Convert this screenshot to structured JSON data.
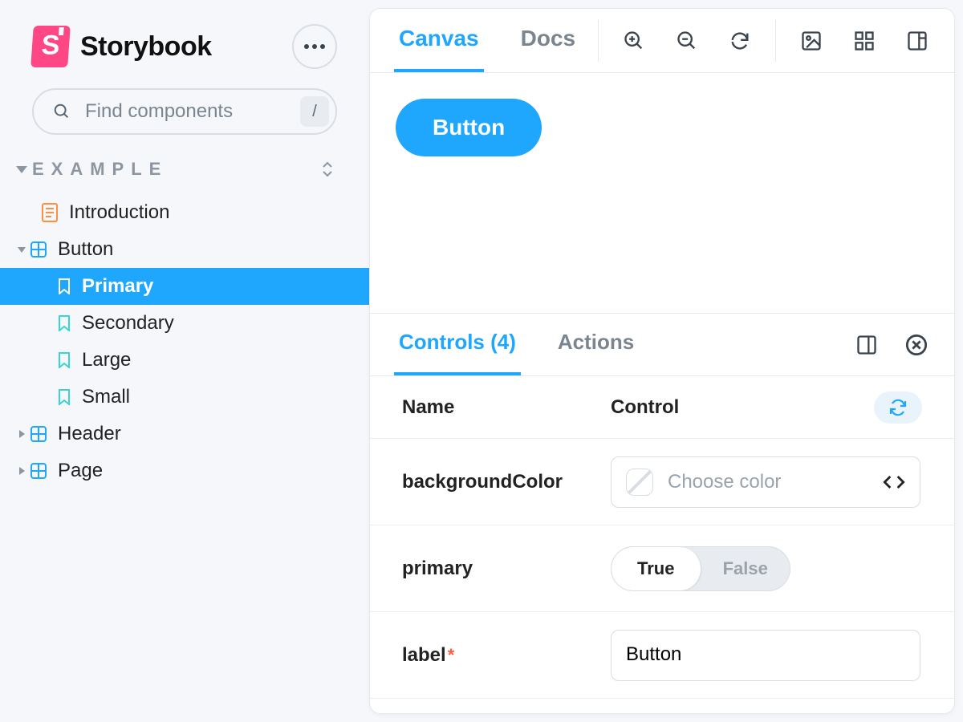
{
  "brand": {
    "name": "Storybook"
  },
  "search": {
    "placeholder": "Find components",
    "shortcut": "/"
  },
  "section": {
    "title": "Example"
  },
  "tree": {
    "introduction": "Introduction",
    "button": "Button",
    "stories": {
      "primary": "Primary",
      "secondary": "Secondary",
      "large": "Large",
      "small": "Small"
    },
    "header": "Header",
    "page": "Page"
  },
  "tabs": {
    "canvas": "Canvas",
    "docs": "Docs"
  },
  "canvas": {
    "button_label": "Button"
  },
  "addon": {
    "tabs": {
      "controls": "Controls (4)",
      "actions": "Actions"
    },
    "columns": {
      "name": "Name",
      "control": "Control"
    }
  },
  "controls": {
    "backgroundColor": {
      "name": "backgroundColor",
      "placeholder": "Choose color"
    },
    "primary": {
      "name": "primary",
      "true": "True",
      "false": "False",
      "value": true
    },
    "label": {
      "name": "label",
      "value": "Button"
    }
  }
}
